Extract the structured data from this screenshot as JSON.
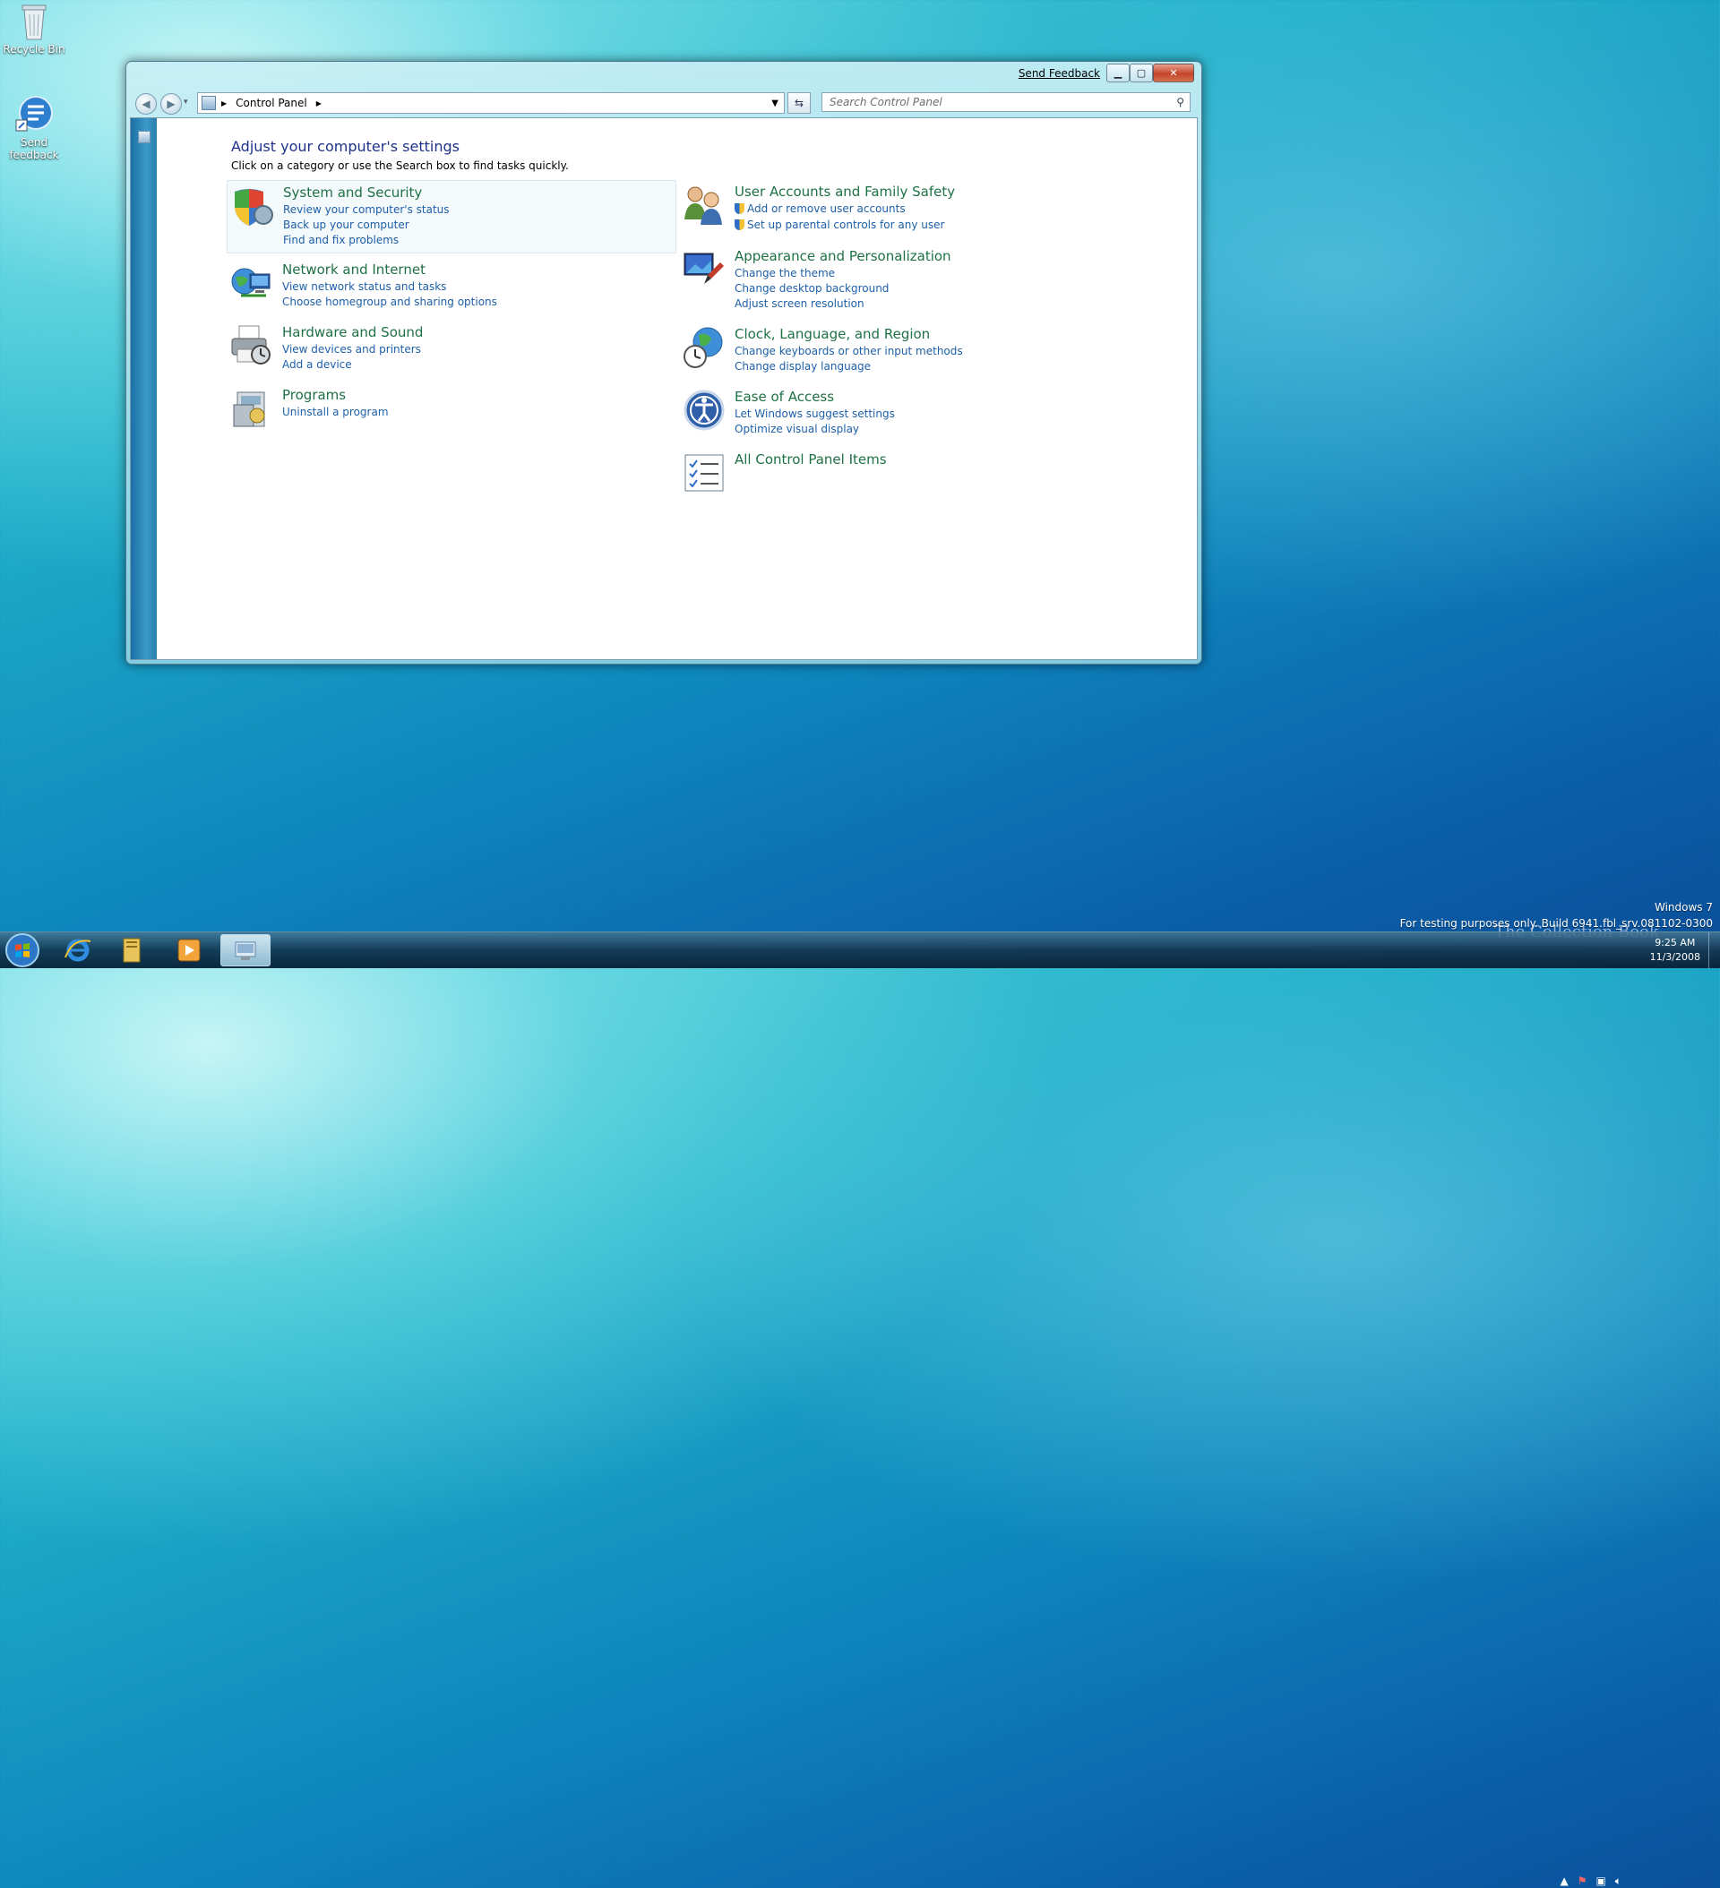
{
  "desktop": {
    "icons": [
      {
        "label": "Recycle Bin"
      },
      {
        "label": "Send\nfeedback"
      }
    ]
  },
  "window": {
    "feedback_label": "Send Feedback",
    "nav": {
      "breadcrumb": "Control Panel",
      "search_placeholder": "Search Control Panel"
    },
    "heading": "Adjust your computer's settings",
    "subheading": "Click on a category or use the Search box to find tasks quickly.",
    "categories_left": [
      {
        "title": "System and Security",
        "links": [
          "Review your computer's status",
          "Back up your computer",
          "Find and fix problems"
        ]
      },
      {
        "title": "Network and Internet",
        "links": [
          "View network status and tasks",
          "Choose homegroup and sharing options"
        ]
      },
      {
        "title": "Hardware and Sound",
        "links": [
          "View devices and printers",
          "Add a device"
        ]
      },
      {
        "title": "Programs",
        "links": [
          "Uninstall a program"
        ]
      }
    ],
    "categories_right": [
      {
        "title": "User Accounts and Family Safety",
        "links": [
          "Add or remove user accounts",
          "Set up parental controls for any user"
        ]
      },
      {
        "title": "Appearance and Personalization",
        "links": [
          "Change the theme",
          "Change desktop background",
          "Adjust screen resolution"
        ]
      },
      {
        "title": "Clock, Language, and Region",
        "links": [
          "Change keyboards or other input methods",
          "Change display language"
        ]
      },
      {
        "title": "Ease of Access",
        "links": [
          "Let Windows suggest settings",
          "Optimize visual display"
        ]
      },
      {
        "title": "All Control Panel Items",
        "links": []
      }
    ]
  },
  "watermark": {
    "line1": "Windows 7",
    "line2": "For testing purposes only. Build 6941.fbl_srv.081102-0300"
  },
  "branding": "The Collection Book",
  "clock": {
    "time": "9:25 AM",
    "date": "11/3/2008"
  }
}
